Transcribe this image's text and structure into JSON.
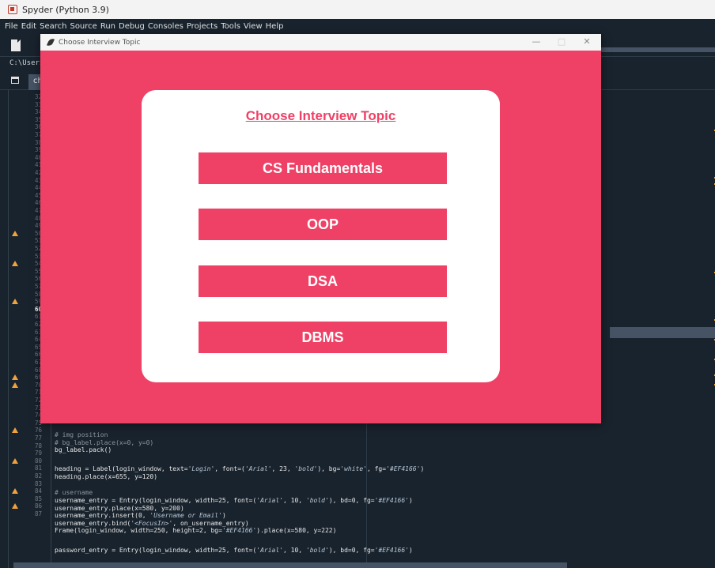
{
  "ide": {
    "title": "Spyder (Python 3.9)",
    "menu": [
      "File",
      "Edit",
      "Search",
      "Source",
      "Run",
      "Debug",
      "Consoles",
      "Projects",
      "Tools",
      "View",
      "Help"
    ],
    "path": "C:\\Users\\p",
    "tab_label": "ch"
  },
  "editor": {
    "line_numbers": [
      "32",
      "33",
      "34",
      "35",
      "36",
      "37",
      "38",
      "39",
      "40",
      "41",
      "42",
      "43",
      "44",
      "45",
      "46",
      "47",
      "48",
      "49",
      "50",
      "51",
      "52",
      "53",
      "54",
      "55",
      "56",
      "57",
      "58",
      "59",
      "60",
      "61",
      "62",
      "63",
      "64",
      "65",
      "66",
      "67",
      "68",
      "69",
      "70",
      "71",
      "72",
      "73",
      "74",
      "75",
      "76",
      "77",
      "78",
      "79",
      "80",
      "81",
      "82",
      "83",
      "84",
      "85",
      "86",
      "87"
    ],
    "current_line": "60",
    "warning_lines": [
      "50",
      "54",
      "59",
      "69",
      "70",
      "76",
      "80",
      "84",
      "86"
    ],
    "code": {
      "l72": "# img position",
      "l73": "# bg_label.place(x=0, y=0)",
      "l74": "bg_label.pack()",
      "l76a": "heading = Label(login_window, text=",
      "l76s1": "'Login'",
      "l76b": ", font=(",
      "l76s2": "'Arial'",
      "l76c": ", 23, ",
      "l76s3": "'bold'",
      "l76d": "), bg=",
      "l76s4": "'white'",
      "l76e": ", fg=",
      "l76s5": "'#EF4166'",
      "l76f": ")",
      "l77": "heading.place(x=655, y=120)",
      "l79": "# username",
      "l80a": "username_entry = Entry(login_window, width=25, font=(",
      "l80s1": "'Arial'",
      "l80b": ", 10, ",
      "l80s2": "'bold'",
      "l80c": "), bd=0, fg=",
      "l80s3": "'#EF4166'",
      "l80d": ")",
      "l81": "username_entry.place(x=580, y=200)",
      "l82a": "username_entry.insert(0, ",
      "l82s": "'Username or Email'",
      "l82b": ")",
      "l83a": "username_entry.bind(",
      "l83s": "'<FocusIn>'",
      "l83b": ", on_username_entry)",
      "l84a": "Frame(login_window, width=250, height=2, bg=",
      "l84s": "'#EF4166'",
      "l84b": ").place(x=580, y=222)",
      "l86a": "password_entry = Entry(login_window, width=25, font=(",
      "l86s1": "'Arial'",
      "l86b": ", 10, ",
      "l86s2": "'bold'",
      "l86c": "), bd=0, fg=",
      "l86s3": "'#EF4166'",
      "l86d": ")"
    }
  },
  "tk_window": {
    "title": "Choose Interview Topic",
    "controls": {
      "minimize": "—",
      "maximize": "□",
      "close": "✕"
    },
    "heading": "Choose Interview Topic",
    "topics": [
      "CS Fundamentals",
      "OOP",
      "DSA",
      "DBMS"
    ],
    "accent_color": "#EF4166"
  }
}
